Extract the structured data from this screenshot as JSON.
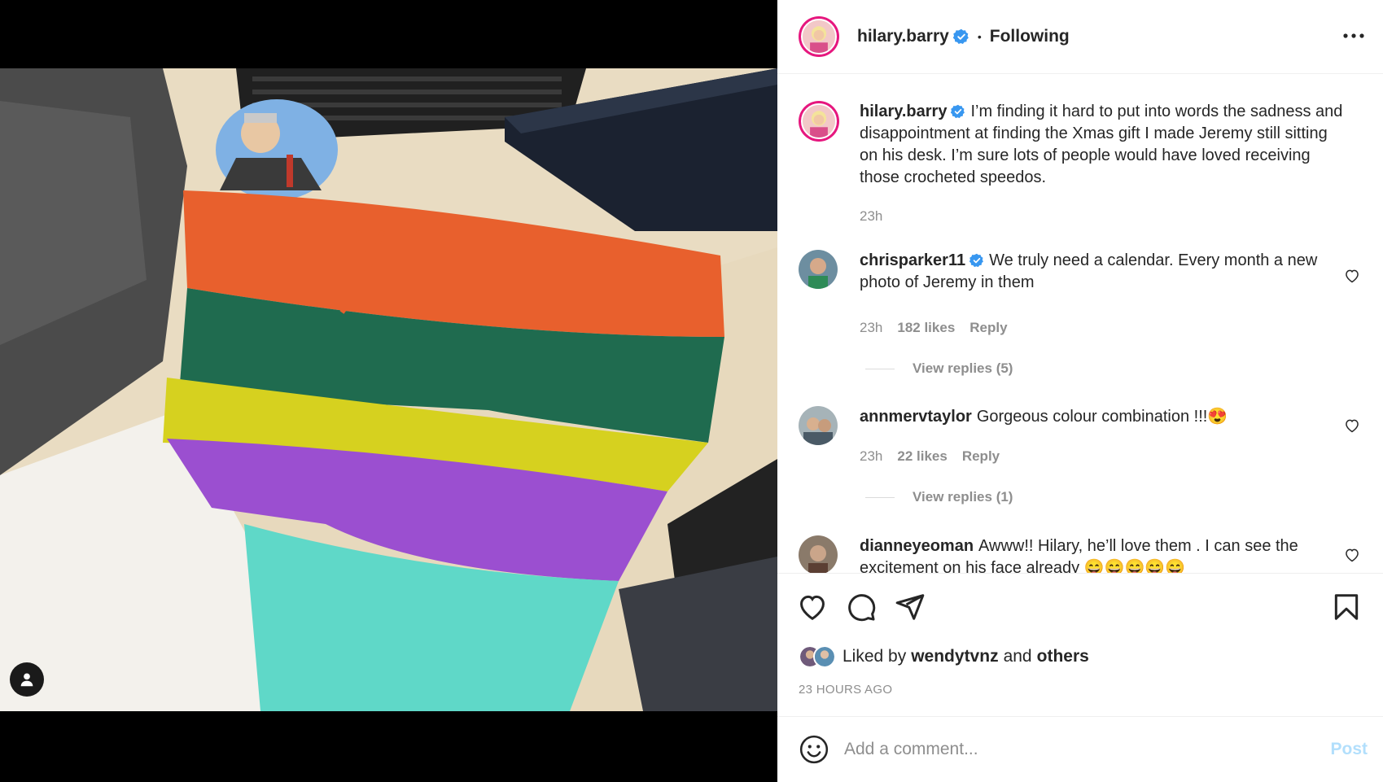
{
  "post": {
    "author": "hilary.barry",
    "follow_status": "Following",
    "caption": "I’m finding it hard to put into words the sadness and disappointment at finding the Xmas gift I made Jeremy still sitting on his desk. I’m sure lots of people would have loved receiving those crocheted speedos.",
    "caption_time": "23h",
    "liked_by_user": "wendytvnz",
    "liked_by_and": "and",
    "liked_by_prefix": "Liked by",
    "liked_by_others": "others",
    "timestamp": "23 HOURS AGO"
  },
  "comments": [
    {
      "username": "chrisparker11",
      "verified": true,
      "text": "We truly need a calendar. Every month a new photo of Jeremy in them",
      "time": "23h",
      "likes": "182 likes",
      "reply": "Reply",
      "view_replies": "View replies (5)"
    },
    {
      "username": "annmervtaylor",
      "verified": false,
      "text": "Gorgeous colour combination !!!😍",
      "time": "23h",
      "likes": "22 likes",
      "reply": "Reply",
      "view_replies": "View replies (1)"
    },
    {
      "username": "dianneyeoman",
      "verified": false,
      "text": "Awww!! Hilary, he’ll love them . I can see the excitement on his face already 😄😄😄😄😄"
    }
  ],
  "compose": {
    "placeholder": "Add a comment...",
    "post_label": "Post"
  },
  "colors": {
    "accent_blue": "#0095f6",
    "post_disabled": "#b2dffc",
    "story_ring": "#e6177e",
    "secondary_text": "#8e8e8e"
  },
  "icons": [
    "verified-badge-icon",
    "more-options-icon",
    "heart-icon",
    "comment-icon",
    "share-icon",
    "bookmark-icon",
    "emoji-icon",
    "user-tag-icon"
  ]
}
